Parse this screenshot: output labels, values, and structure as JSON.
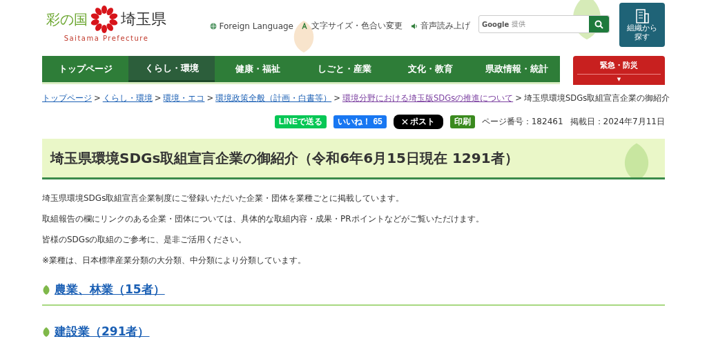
{
  "header": {
    "logo": {
      "tagline": "彩の国",
      "name": "埼玉県",
      "subtitle": "Saitama Prefecture"
    },
    "utility_links": [
      {
        "kind": "globe",
        "label": "Foreign Language"
      },
      {
        "kind": "font",
        "label": "文字サイズ・色合い変更"
      },
      {
        "kind": "speaker",
        "label": "音声読み上げ"
      }
    ],
    "search": {
      "brand": "Google",
      "placeholder": "提供"
    },
    "org_button": "組織から探す"
  },
  "nav": {
    "items": [
      {
        "label": "トップページ",
        "selected": false
      },
      {
        "label": "くらし・環境",
        "selected": true
      },
      {
        "label": "健康・福祉",
        "selected": false
      },
      {
        "label": "しごと・産業",
        "selected": false
      },
      {
        "label": "文化・教育",
        "selected": false
      },
      {
        "label": "県政情報・統計",
        "selected": false
      }
    ],
    "emergency": {
      "label": "緊急・防災",
      "caret": "▼"
    }
  },
  "breadcrumb": {
    "links": [
      "トップページ",
      "くらし・環境",
      "環境・エコ",
      "環境政策全般（計画・白書等）",
      "環境分野における埼玉版SDGsの推進について"
    ],
    "separator": ">",
    "current": "埼玉県環境SDGs取組宣言企業の御紹介"
  },
  "share": {
    "line": "LINEで送る",
    "like": "いいね！",
    "like_count": "65",
    "post": "ポスト",
    "print": "印刷",
    "page_number": "ページ番号：182461",
    "published": "掲載日：2024年7月11日"
  },
  "title": "埼玉県環境SDGs取組宣言企業の御紹介（令和6年6月15日現在 1291者）",
  "paragraphs": [
    "埼玉県環境SDGs取組宣言企業制度にご登録いただいた企業・団体を業種ごとに掲載しています。",
    "取組報告の欄にリンクのある企業・団体については、具体的な取組内容・成果・PRポイントなどがご覧いただけます。",
    "皆様のSDGsの取組のご参考に、是非ご活用ください。",
    "※業種は、日本標準産業分類の大分類、中分類により分類しています。"
  ],
  "sections": [
    "農業、林業（15者）",
    "建設業（291者）"
  ]
}
